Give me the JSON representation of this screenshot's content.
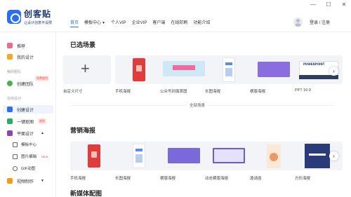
{
  "window": {
    "minimize": "—",
    "maximize": "☐",
    "close": "✕"
  },
  "logo": {
    "title": "创客贴",
    "subtitle": "让设计创意不设限"
  },
  "nav": [
    {
      "label": "首页",
      "active": true
    },
    {
      "label": "模板中心",
      "dropdown": true
    },
    {
      "label": "个人VIP"
    },
    {
      "label": "企业VIP"
    },
    {
      "label": "客户端"
    },
    {
      "label": "在线印刷"
    },
    {
      "label": "功能介绍"
    }
  ],
  "user": {
    "login_label": "登录 / 注册"
  },
  "sidebar": {
    "recommend": "推荐",
    "my_design": "我的设计",
    "team_section": "我的团队",
    "team_badge": "免费使用",
    "create_team": "创建团队",
    "online_section": "在线设计",
    "create_design": "创建设计",
    "cutout": "一键抠图",
    "cutout_badge": "限免",
    "graphic_design": "平面设计",
    "template_center": "模板中心",
    "image_edit": "图片编辑",
    "image_edit_badge": "NEW",
    "gif": "GIF动图",
    "video": "视频制作"
  },
  "selected_scenes": {
    "title": "已选场景",
    "items": [
      "自定义尺寸",
      "手机海报",
      "公众号封面首图",
      "长图海报",
      "横版海报",
      "PPT 16:9"
    ],
    "ppt_thumb_text": "POWERPOINT"
  },
  "all_scenes_label": "全部场景",
  "marketing": {
    "title": "营销海报",
    "items": [
      "手机海报",
      "长图海报",
      "横版海报",
      "动态横版海报",
      "邀请函",
      "方形海报"
    ]
  },
  "new_media": {
    "title": "新媒体配图"
  },
  "colors": {
    "accent": "#2b6ff0",
    "red": "#e23b3b"
  }
}
